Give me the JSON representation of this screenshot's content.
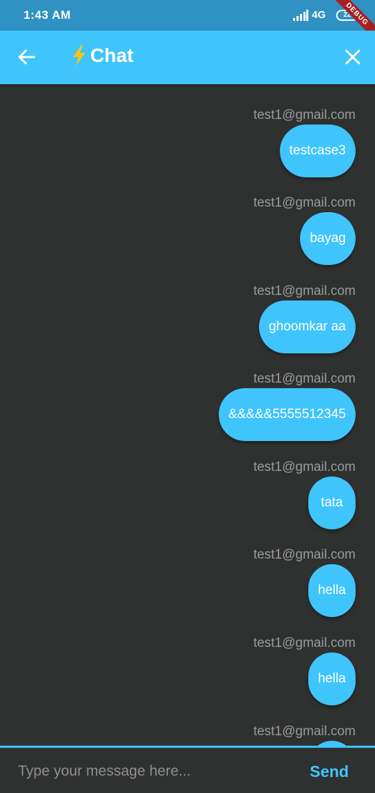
{
  "status_bar": {
    "time": "1:43 AM",
    "network": "4G",
    "battery": "22",
    "debug_label": "DEBUG"
  },
  "app_bar": {
    "title": "Chat"
  },
  "messages": [
    {
      "sender": "test1@gmail.com",
      "text": "testcase3"
    },
    {
      "sender": "test1@gmail.com",
      "text": "bayag"
    },
    {
      "sender": "test1@gmail.com",
      "text": "ghoomkar aa"
    },
    {
      "sender": "test1@gmail.com",
      "text": "&&&&&5555512345"
    },
    {
      "sender": "test1@gmail.com",
      "text": "tata"
    },
    {
      "sender": "test1@gmail.com",
      "text": "hella"
    },
    {
      "sender": "test1@gmail.com",
      "text": "hella"
    },
    {
      "sender": "test1@gmail.com",
      "text": ""
    }
  ],
  "composer": {
    "placeholder": "Type your message here...",
    "send_label": "Send"
  },
  "colors": {
    "accent": "#40c4fc",
    "status_bar": "#2f92c2",
    "background": "#2f3130",
    "sender_text": "#9a9a9a"
  }
}
